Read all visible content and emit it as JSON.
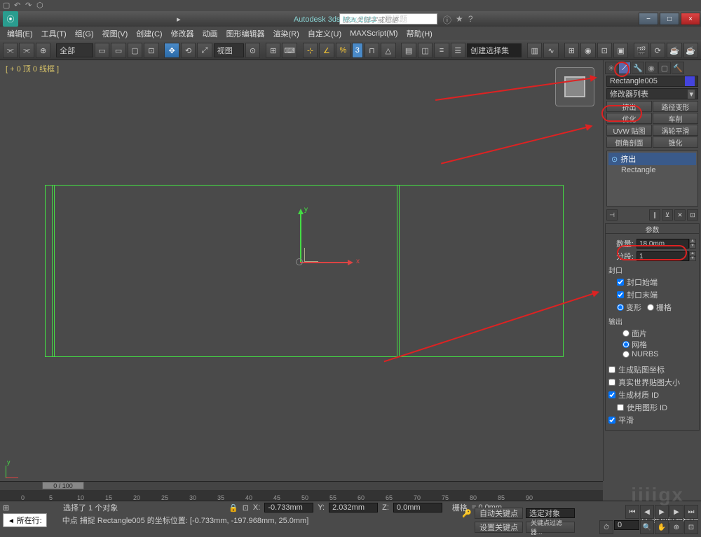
{
  "title": {
    "app": "Autodesk 3ds Max  2012",
    "doc": "无标题",
    "search_placeholder": "键入关键字或短语"
  },
  "menus": [
    "编辑(E)",
    "工具(T)",
    "组(G)",
    "视图(V)",
    "创建(C)",
    "修改器",
    "动画",
    "图形编辑器",
    "渲染(R)",
    "自定义(U)",
    "MAXScript(M)",
    "帮助(H)"
  ],
  "toolbar": {
    "scope": "全部",
    "view_btn": "视图",
    "selset": "创建选择集"
  },
  "viewport": {
    "label": "[ + 0 顶 0 线框 ]",
    "y": "y",
    "x": "x"
  },
  "cmdpanel": {
    "objname": "Rectangle005",
    "modlist": "修改器列表",
    "modbtns": [
      "挤出",
      "路径变形",
      "优化",
      "车削",
      "UVW 贴图",
      "涡轮平滑",
      "倒角剖面",
      "锥化"
    ],
    "stack": [
      {
        "name": "挤出",
        "sel": true
      },
      {
        "name": "Rectangle",
        "sel": false
      }
    ],
    "rollout_params": "参数",
    "p_amount_lbl": "数量:",
    "p_amount": "18.0mm",
    "p_segs_lbl": "分段:",
    "p_segs": "1",
    "cap_section": "封口",
    "cap_start": "封口始端",
    "cap_end": "封口末端",
    "cap_morph": "变形",
    "cap_grid": "栅格",
    "output_section": "输出",
    "out_patch": "面片",
    "out_mesh": "网格",
    "out_nurbs": "NURBS",
    "gen_map": "生成贴图坐标",
    "real_world": "真实世界贴图大小",
    "gen_mat": "生成材质 ID",
    "use_shape": "使用图形 ID",
    "smooth": "平滑"
  },
  "timeline": {
    "pos": "0 / 100",
    "ticks": [
      "0",
      "5",
      "10",
      "15",
      "20",
      "25",
      "30",
      "35",
      "40",
      "45",
      "50",
      "55",
      "60",
      "65",
      "70",
      "75",
      "80",
      "85",
      "90"
    ]
  },
  "status": {
    "sel": "选择了 1 个对象",
    "snap": "中点 捕捉 Rectangle005 的坐标位置: [-0.733mm, -197.968mm, 25.0mm]",
    "x_lbl": "X:",
    "x": "-0.733mm",
    "y_lbl": "Y:",
    "y": "2.032mm",
    "z_lbl": "Z:",
    "z": "0.0mm",
    "grid_lbl": "栅格",
    "grid": "= 0.0mm",
    "autokey": "自动关键点",
    "selonly": "选定对象",
    "setkey": "设置关键点",
    "keyfilter": "关键点过滤器...",
    "addtime": "添加时间标记",
    "current": "所在行:"
  }
}
